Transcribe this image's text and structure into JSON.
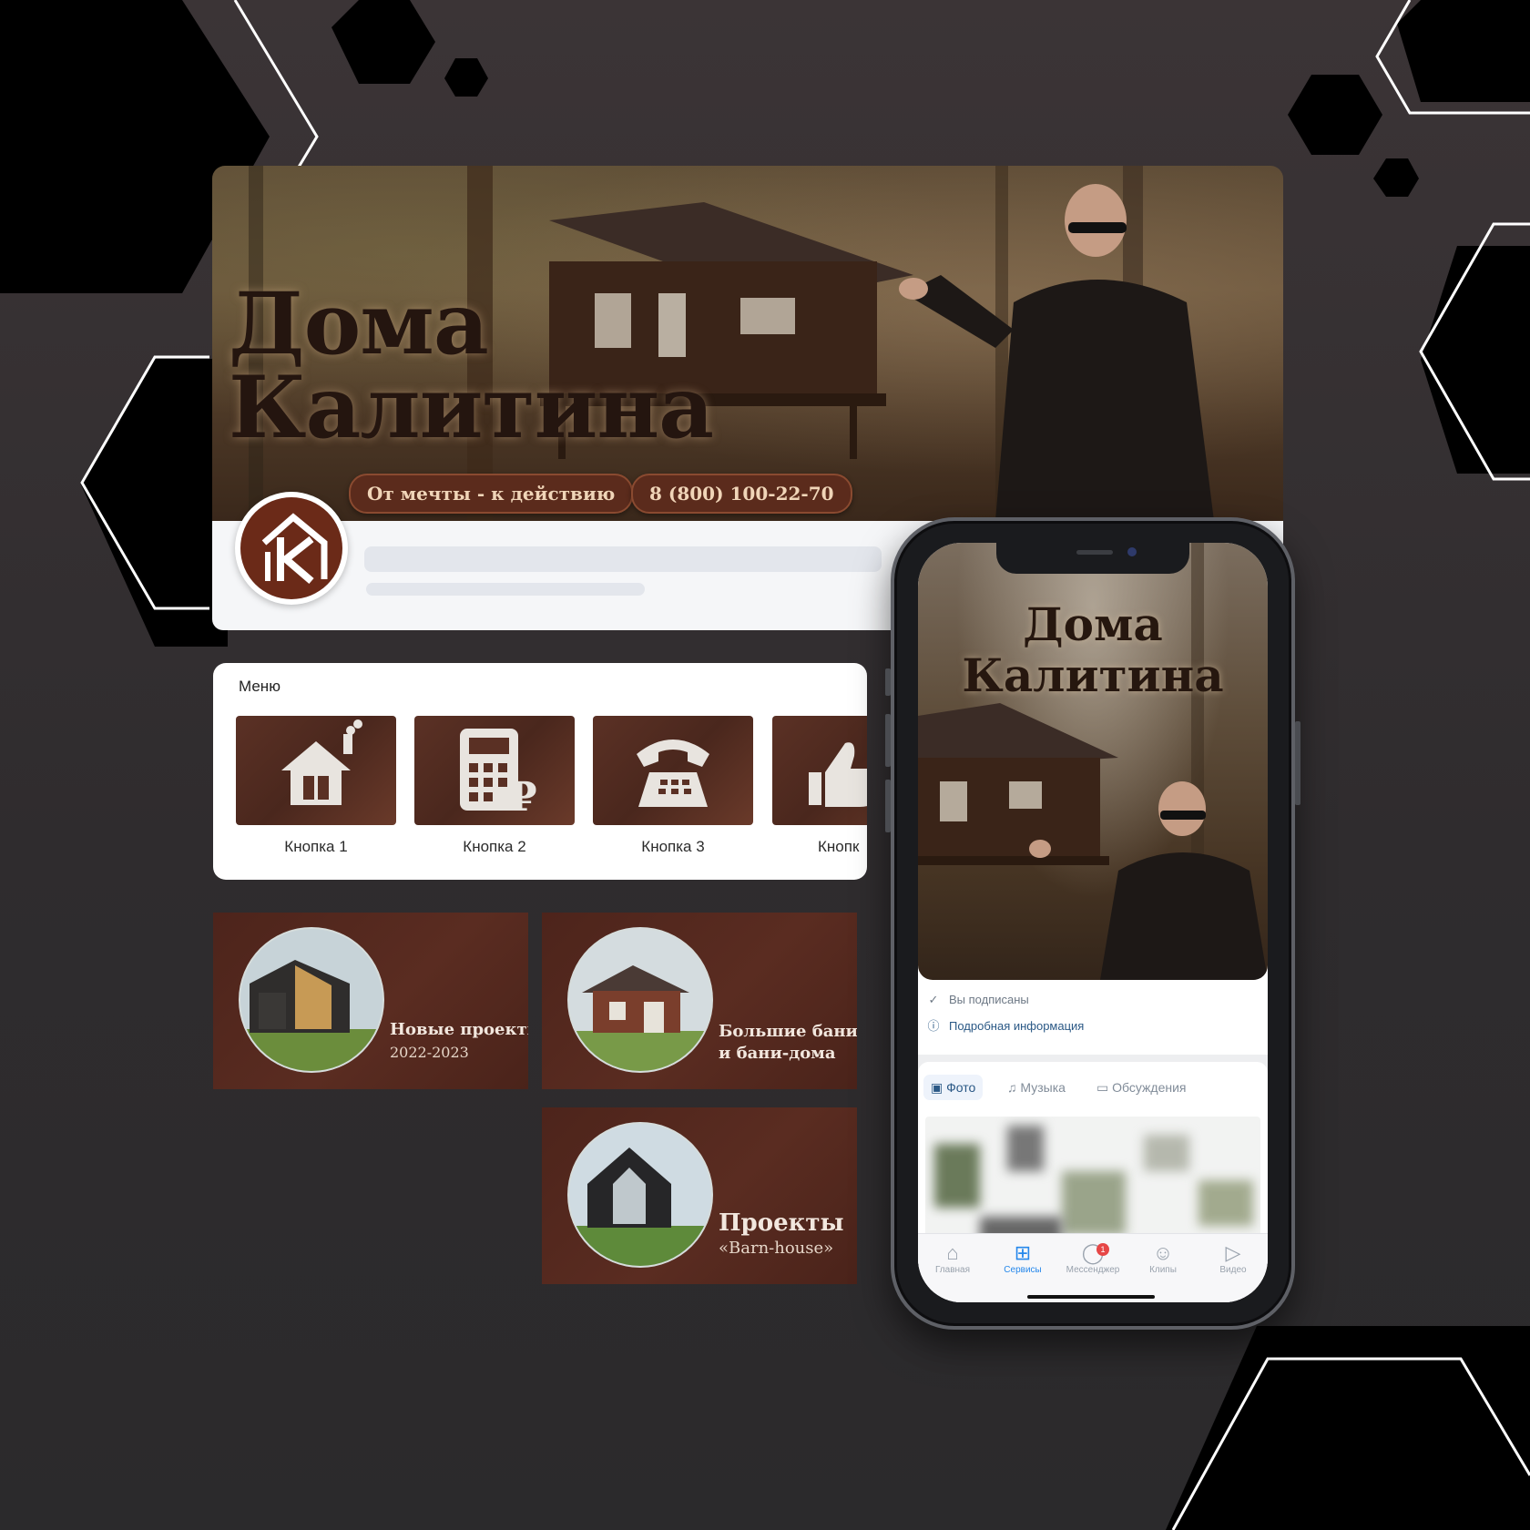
{
  "cover": {
    "title_line1": "Дома",
    "title_line2": "Калитина",
    "slogan": "От мечты - к действию",
    "phone": "8 (800) 100-22-70"
  },
  "menu": {
    "title": "Меню",
    "items": [
      {
        "label": "Кнопка 1",
        "icon": "house-icon"
      },
      {
        "label": "Кнопка 2",
        "icon": "calculator-ruble-icon"
      },
      {
        "label": "Кнопка 3",
        "icon": "telephone-icon"
      },
      {
        "label": "Кнопк",
        "icon": "thumbs-up-icon"
      }
    ]
  },
  "tiles": [
    {
      "title": "Новые проекты",
      "subtitle": "2022-2023"
    },
    {
      "title": "Большие бани",
      "subtitle": "и бани-дома"
    },
    {
      "title": "Проекты",
      "subtitle": "«Barn-house»"
    }
  ],
  "phone": {
    "title_line1": "Дома",
    "title_line2": "Калитина",
    "subscribed": "Вы подписаны",
    "details": "Подробная информация",
    "tabs": [
      "Фото",
      "Музыка",
      "Обсуждения"
    ],
    "nav": [
      {
        "label": "Главная",
        "icon": "home-icon"
      },
      {
        "label": "Сервисы",
        "icon": "services-grid-icon"
      },
      {
        "label": "Мессенджер",
        "icon": "chat-bubble-icon",
        "badge": "1"
      },
      {
        "label": "Клипы",
        "icon": "clips-icon"
      },
      {
        "label": "Видео",
        "icon": "video-play-icon"
      }
    ]
  },
  "colors": {
    "brand_brown": "#5b2b1c",
    "background": "#2f2c2e",
    "vk_blue": "#2a5885",
    "badge_red": "#e64646"
  }
}
